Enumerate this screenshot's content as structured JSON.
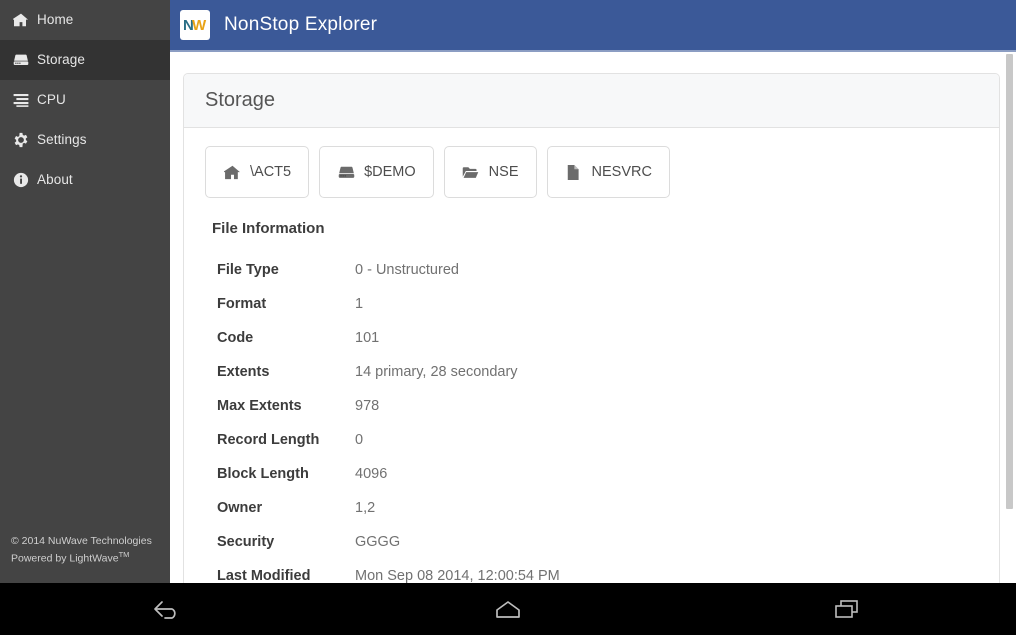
{
  "app": {
    "title": "NonStop Explorer",
    "logo_icon": "nuwave-nw-logo",
    "header_color": "#3b5998",
    "header_accent_color": "#8b9dc3"
  },
  "sidebar": {
    "background_color": "#444444",
    "active_color": "#333333",
    "items": [
      {
        "label": "Home",
        "icon": "home-icon",
        "active": false
      },
      {
        "label": "Storage",
        "icon": "hdd-icon",
        "active": true
      },
      {
        "label": "CPU",
        "icon": "tasks-icon",
        "active": false
      },
      {
        "label": "Settings",
        "icon": "gear-icon",
        "active": false
      },
      {
        "label": "About",
        "icon": "info-circle-icon",
        "active": false
      }
    ],
    "footer": {
      "copyright": "© 2014 NuWave Technologies",
      "powered_by_prefix": "Powered by LightWave",
      "powered_by_suffix": "TM"
    }
  },
  "panel": {
    "title": "Storage",
    "breadcrumbs": [
      {
        "label": "\\ACT5",
        "icon": "home-icon"
      },
      {
        "label": "$DEMO",
        "icon": "hdd-icon"
      },
      {
        "label": "NSE",
        "icon": "folder-open-icon"
      },
      {
        "label": "NESVRC",
        "icon": "file-icon"
      }
    ],
    "file_information": {
      "heading": "File Information",
      "rows": [
        {
          "key": "File Type",
          "value": "0 - Unstructured"
        },
        {
          "key": "Format",
          "value": "1"
        },
        {
          "key": "Code",
          "value": "101"
        },
        {
          "key": "Extents",
          "value": "14 primary, 28 secondary"
        },
        {
          "key": "Max Extents",
          "value": "978"
        },
        {
          "key": "Record Length",
          "value": "0"
        },
        {
          "key": "Block Length",
          "value": "4096"
        },
        {
          "key": "Owner",
          "value": "1,2"
        },
        {
          "key": "Security",
          "value": "GGGG"
        },
        {
          "key": "Last Modified",
          "value": "Mon Sep 08 2014, 12:00:54 PM"
        }
      ]
    }
  },
  "android_navbar": {
    "buttons": [
      {
        "name": "back-icon"
      },
      {
        "name": "home-icon"
      },
      {
        "name": "recents-icon"
      }
    ]
  }
}
